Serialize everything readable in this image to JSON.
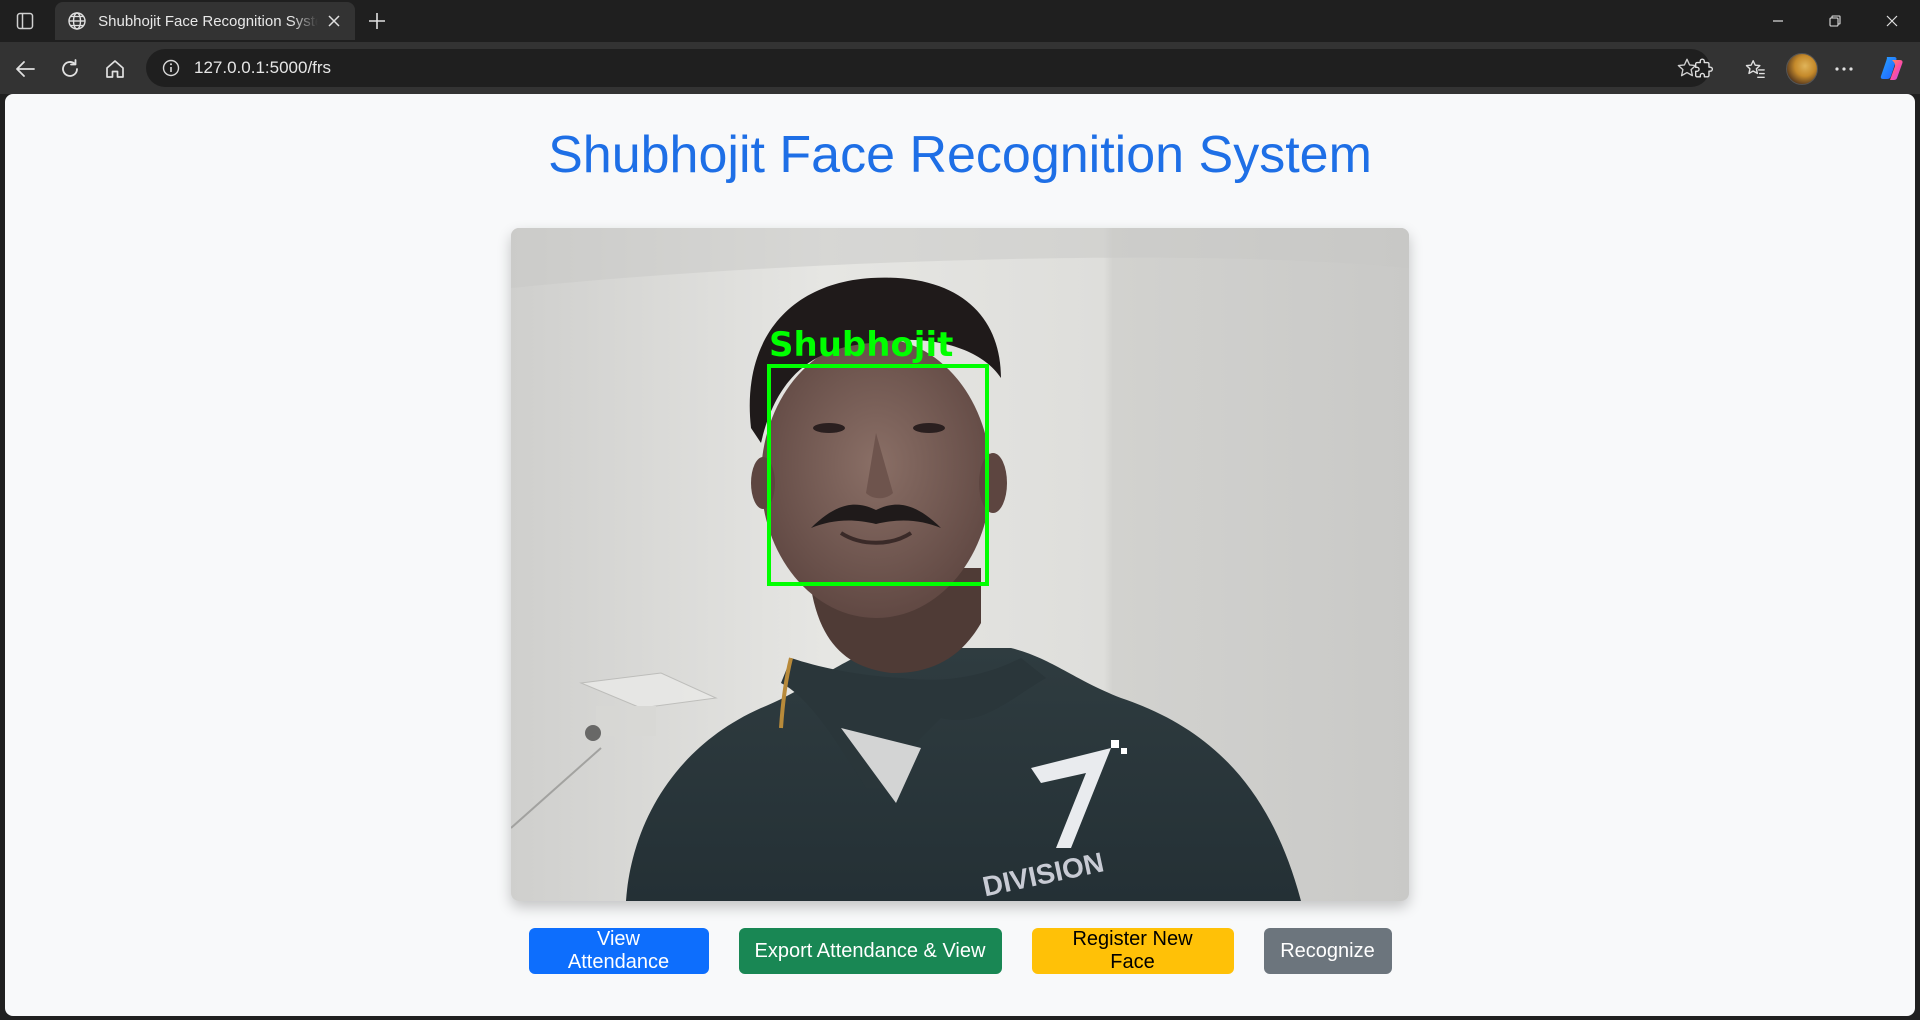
{
  "browser": {
    "tab": {
      "title": "Shubhojit Face Recognition System",
      "icon": "globe-icon"
    },
    "address_bar": {
      "url": "127.0.0.1:5000/frs",
      "icon": "info-icon"
    },
    "toolbar_icons": [
      "back-icon",
      "refresh-icon",
      "home-icon",
      "star-icon",
      "extensions-icon",
      "favorites-icon",
      "avatar",
      "more-icon",
      "copilot-icon"
    ],
    "window_controls": [
      "minimize-icon",
      "restore-icon",
      "close-icon"
    ]
  },
  "page": {
    "title": "Shubhojit Face Recognition System",
    "title_color": "#1e6fe6",
    "video_feed": {
      "detected_label": "Shubhojit",
      "box_color": "#00ff00"
    },
    "buttons": {
      "view_attendance": "View Attendance",
      "export_attendance": "Export Attendance & View",
      "register_face": "Register New Face",
      "recognize": "Recognize"
    },
    "button_colors": {
      "view_attendance": "#0d6efd",
      "export_attendance": "#198754",
      "register_face": "#ffc107",
      "recognize": "#6c757d"
    }
  }
}
